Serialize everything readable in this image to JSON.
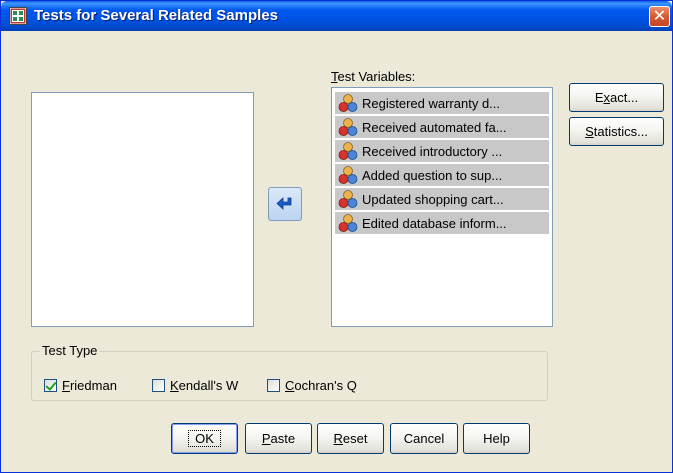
{
  "window": {
    "title": "Tests for Several Related Samples",
    "close_glyph": "✕"
  },
  "test_variables": {
    "label_prefix": "",
    "label_mnemonic": "T",
    "label_rest": "est Variables:",
    "items": [
      {
        "label": "Registered warranty d...",
        "icon": "scale-variable-icon"
      },
      {
        "label": "Received automated fa...",
        "icon": "scale-variable-icon"
      },
      {
        "label": "Received introductory ...",
        "icon": "scale-variable-icon"
      },
      {
        "label": "Added question to sup...",
        "icon": "scale-variable-icon"
      },
      {
        "label": "Updated shopping cart...",
        "icon": "scale-variable-icon"
      },
      {
        "label": "Edited database inform...",
        "icon": "scale-variable-icon"
      }
    ]
  },
  "side_buttons": {
    "exact_pre": "E",
    "exact_mn": "x",
    "exact_post": "act...",
    "statistics_pre": "",
    "statistics_mn": "S",
    "statistics_post": "tatistics..."
  },
  "test_type": {
    "legend": "Test Type",
    "options": [
      {
        "mn": "F",
        "rest": "riedman",
        "checked": true
      },
      {
        "mn": "K",
        "rest": "endall's W",
        "checked": false
      },
      {
        "mn": "C",
        "rest": "ochran's Q",
        "checked": false
      }
    ]
  },
  "buttons": {
    "ok": "OK",
    "paste_mn": "P",
    "paste_rest": "aste",
    "reset_mn": "R",
    "reset_rest": "eset",
    "cancel": "Cancel",
    "help": "Help"
  },
  "colors": {
    "title_bar": "#0054e3",
    "dialog_bg": "#ece9d8",
    "selected_item": "#c8c8c8"
  }
}
